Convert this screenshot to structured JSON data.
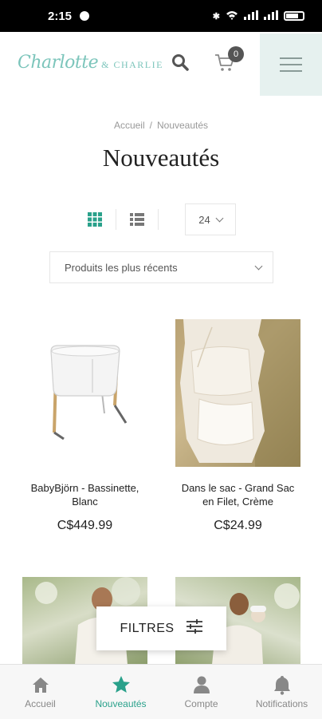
{
  "status_bar": {
    "time": "2:15"
  },
  "header": {
    "logo_script": "Charlotte",
    "logo_caps": "& CHARLIE",
    "cart_count": "0"
  },
  "breadcrumb": {
    "home": "Accueil",
    "separator": "/",
    "current": "Nouveautés"
  },
  "page_title": "Nouveautés",
  "toolbar": {
    "per_page": "24",
    "sort_selected": "Produits les plus récents"
  },
  "products": [
    {
      "name": "BabyBjörn - Bassinette, Blanc",
      "price": "C$449.99"
    },
    {
      "name": "Dans le sac - Grand Sac en Filet, Crème",
      "price": "C$24.99"
    }
  ],
  "filters_label": "FILTRES",
  "tabbar": {
    "items": [
      {
        "label": "Accueil",
        "icon": "home-icon"
      },
      {
        "label": "Nouveautés",
        "icon": "star-icon"
      },
      {
        "label": "Compte",
        "icon": "user-icon"
      },
      {
        "label": "Notifications",
        "icon": "bell-icon"
      }
    ]
  },
  "colors": {
    "accent": "#2aa18b",
    "logo": "#7cc5bb",
    "menu_bg": "#e6f1ef"
  }
}
